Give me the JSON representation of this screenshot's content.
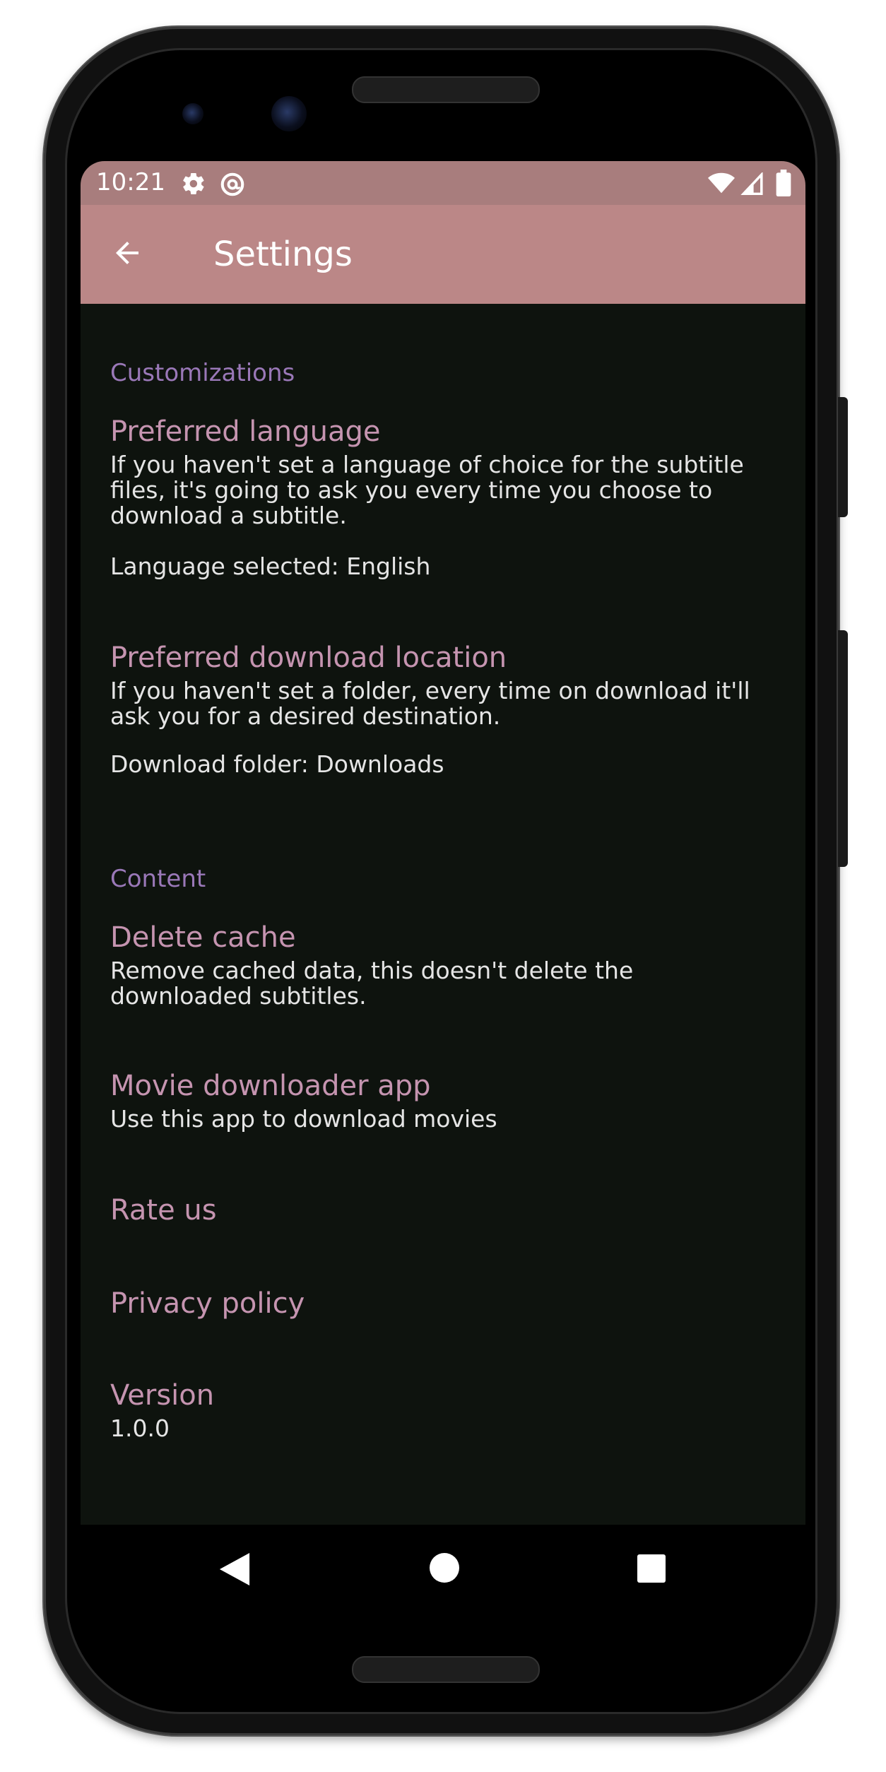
{
  "status_bar": {
    "time": "10:21",
    "left_icons": [
      "gear-icon",
      "at-sign-icon"
    ],
    "right_icons": [
      "wifi-icon",
      "signal-icon",
      "battery-icon"
    ]
  },
  "app_bar": {
    "title": "Settings",
    "back_icon": "arrow-left-icon"
  },
  "sections": {
    "customizations": {
      "header": "Customizations",
      "preferred_language": {
        "title": "Preferred language",
        "summary": "If you haven't set a language of choice for the subtitle files, it's going to ask you every time you choose to download a subtitle.",
        "value": "Language selected: English"
      },
      "preferred_download_location": {
        "title": "Preferred download location",
        "summary": "If you haven't set a folder, every time on download it'll ask you for a desired destination.",
        "value": "Download folder: Downloads"
      }
    },
    "content": {
      "header": "Content",
      "delete_cache": {
        "title": "Delete cache",
        "summary": "Remove cached data, this doesn't delete the downloaded subtitles."
      },
      "movie_downloader": {
        "title": "Movie downloader app",
        "summary": "Use this app to download movies"
      },
      "rate_us": {
        "title": "Rate us"
      },
      "privacy_policy": {
        "title": "Privacy policy"
      },
      "version": {
        "title": "Version",
        "summary": "1.0.0"
      }
    }
  },
  "nav_bar": {
    "buttons": [
      "back-triangle-icon",
      "home-circle-icon",
      "recents-square-icon"
    ]
  },
  "colors": {
    "status_bar": "#a87d7d",
    "app_bar": "#bb8787",
    "background": "#0e130e",
    "section_header": "#9a78b8",
    "pref_title": "#c594b0",
    "pref_summary": "#e5e5e5"
  }
}
